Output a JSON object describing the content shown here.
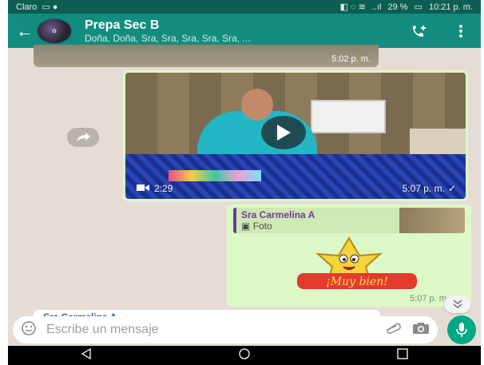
{
  "status_bar": {
    "carrier": "Claro",
    "signal": "..ıl",
    "battery": "29 %",
    "time": "10:21 p. m."
  },
  "header": {
    "title": "Prepa Sec B",
    "subtitle": "Doña, Doña, Sra, Sra, Sra, Sra, Sra, ..."
  },
  "messages": {
    "previous_media_time": "5:02 p. m.",
    "video": {
      "duration": "2:29",
      "time": "5:07 p. m."
    },
    "sticker_reply": {
      "quoted_author": "Sra Carmelina A",
      "quoted_kind": "Foto",
      "sticker_text": "¡Muy bien!",
      "time": "5:07 p. m."
    },
    "partial_message_author": "Sra Carmelina A"
  },
  "input": {
    "placeholder": "Escribe un mensaje"
  },
  "colors": {
    "appbar": "#128c7e",
    "statusbar": "#0c5e54",
    "outgoing_bubble": "#dcf8c6",
    "chat_background": "#e5ddd5",
    "mic_button": "#00a884"
  },
  "icons": {
    "back": "arrow-left-icon",
    "call": "add-call-icon",
    "menu": "more-vert-icon",
    "forward": "forward-icon",
    "play": "play-icon",
    "video": "video-camera-icon",
    "emoji": "emoji-icon",
    "attach": "paperclip-icon",
    "camera": "camera-icon",
    "mic": "microphone-icon",
    "scroll": "double-chevron-down-icon"
  }
}
